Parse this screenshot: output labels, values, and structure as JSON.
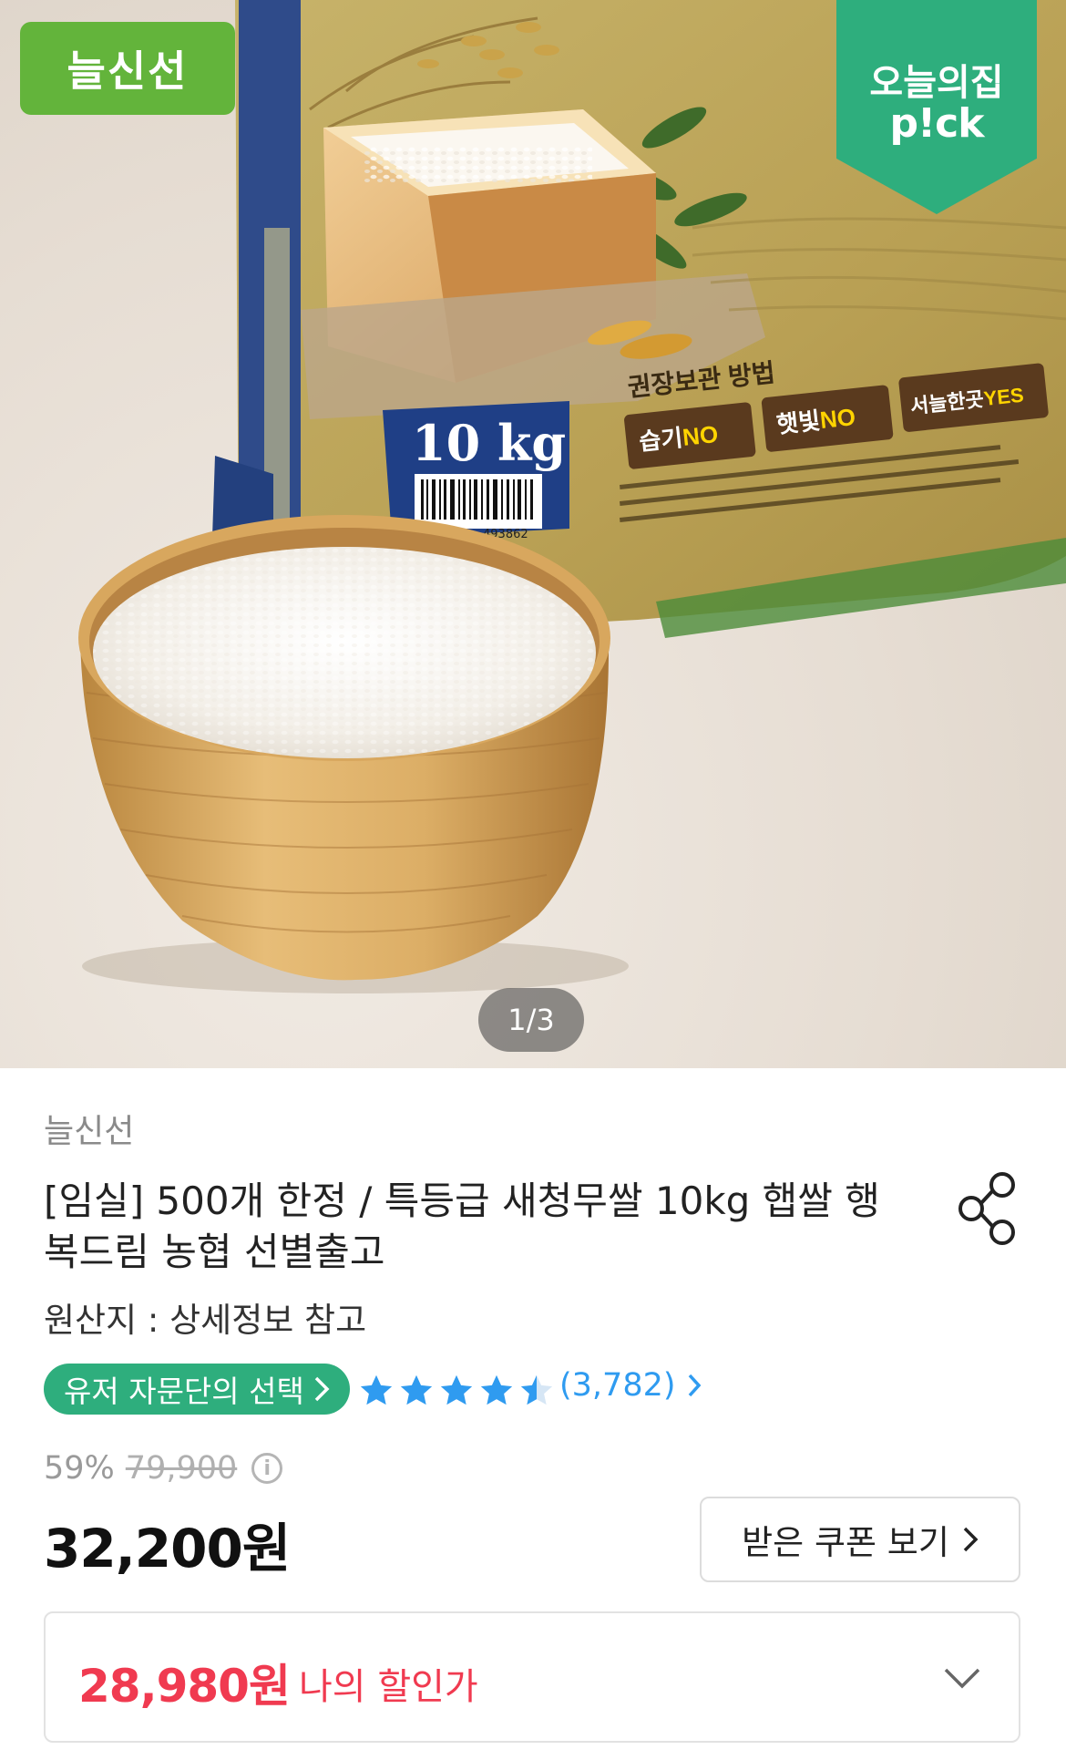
{
  "hero": {
    "seller_badge": "늘신선",
    "pick_badge_line1": "오늘의집",
    "pick_badge_line2": "p!ck",
    "image_counter": "1/3",
    "package_weight": "10 kg",
    "package_storage_title": "권장보관 방법",
    "package_tags": [
      "습기NO",
      "햇빛NO",
      "서늘한곳YES"
    ],
    "barcode_digits": "493862"
  },
  "product": {
    "brand": "늘신선",
    "title": "[임실] 500개 한정 / 특등급 새청무쌀 10kg 햅쌀 행복드림 농협 선별출고",
    "origin": "원산지 : 상세정보 참고",
    "advisor_badge": "유저 자문단의 선택",
    "rating": 4.5,
    "review_count": "(3,782)",
    "discount_rate": "59%",
    "original_price": "79,900",
    "price": "32,200원",
    "coupon_button": "받은 쿠폰 보기",
    "my_price": "28,980원",
    "my_price_label": "나의 할인가"
  },
  "colors": {
    "brand_green": "#63b43b",
    "pick_green": "#2eae7d",
    "star_blue": "#2f9bf0",
    "sale_red": "#f03a50"
  },
  "icons": [
    "share-icon",
    "star-icon",
    "chevron-right-icon",
    "info-icon",
    "chevron-down-icon"
  ]
}
